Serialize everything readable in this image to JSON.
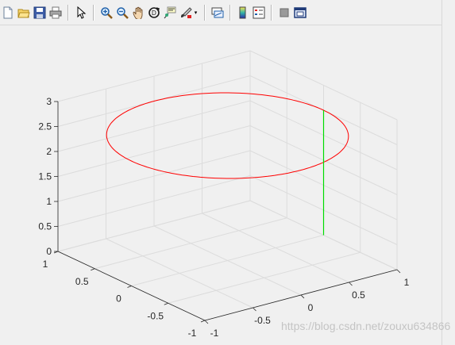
{
  "toolbar": {
    "buttons": [
      {
        "icon": "new-figure-icon"
      },
      {
        "icon": "open-file-icon"
      },
      {
        "icon": "save-icon"
      },
      {
        "icon": "print-icon"
      },
      {
        "sep": true
      },
      {
        "icon": "edit-plot-icon"
      },
      {
        "sep": true
      },
      {
        "icon": "zoom-in-icon"
      },
      {
        "icon": "zoom-out-icon"
      },
      {
        "icon": "pan-icon"
      },
      {
        "icon": "rotate-3d-icon"
      },
      {
        "icon": "data-cursor-icon"
      },
      {
        "icon": "brush-icon",
        "dropdown": true
      },
      {
        "sep": true
      },
      {
        "icon": "link-plot-icon"
      },
      {
        "sep": true
      },
      {
        "icon": "colorbar-icon"
      },
      {
        "icon": "legend-icon"
      },
      {
        "sep": true
      },
      {
        "icon": "hide-plot-tools-icon"
      },
      {
        "icon": "show-plot-tools-icon"
      }
    ]
  },
  "chart_data": {
    "type": "line",
    "projection": "3d",
    "grid": true,
    "xlim": [
      -1,
      1
    ],
    "ylim": [
      -1,
      1
    ],
    "zlim": [
      0,
      3
    ],
    "xticks": [
      "-1",
      "-0.5",
      "0",
      "0.5",
      "1"
    ],
    "yticks": [
      "-1",
      "-0.5",
      "0",
      "0.5",
      "1"
    ],
    "zticks": [
      "0",
      "0.5",
      "1",
      "1.5",
      "2",
      "2.5",
      "3"
    ],
    "series": [
      {
        "color": "#ff0000",
        "description": "circle of radius 1 at z = 2.5",
        "parametric": {
          "x": "cos(t)",
          "y": "sin(t)",
          "z": 2.5,
          "t": [
            0,
            6.2832
          ]
        }
      },
      {
        "color": "#00dd00",
        "points": [
          [
            1,
            0,
            0
          ],
          [
            1,
            0,
            2.5
          ]
        ]
      }
    ]
  },
  "watermark": "https://blog.csdn.net/zouxu634866",
  "colors": {
    "background": "#f0f0f0",
    "axes_background": "#f0f0f0",
    "grid": "#dcdcdc",
    "axis_line": "#262626"
  }
}
